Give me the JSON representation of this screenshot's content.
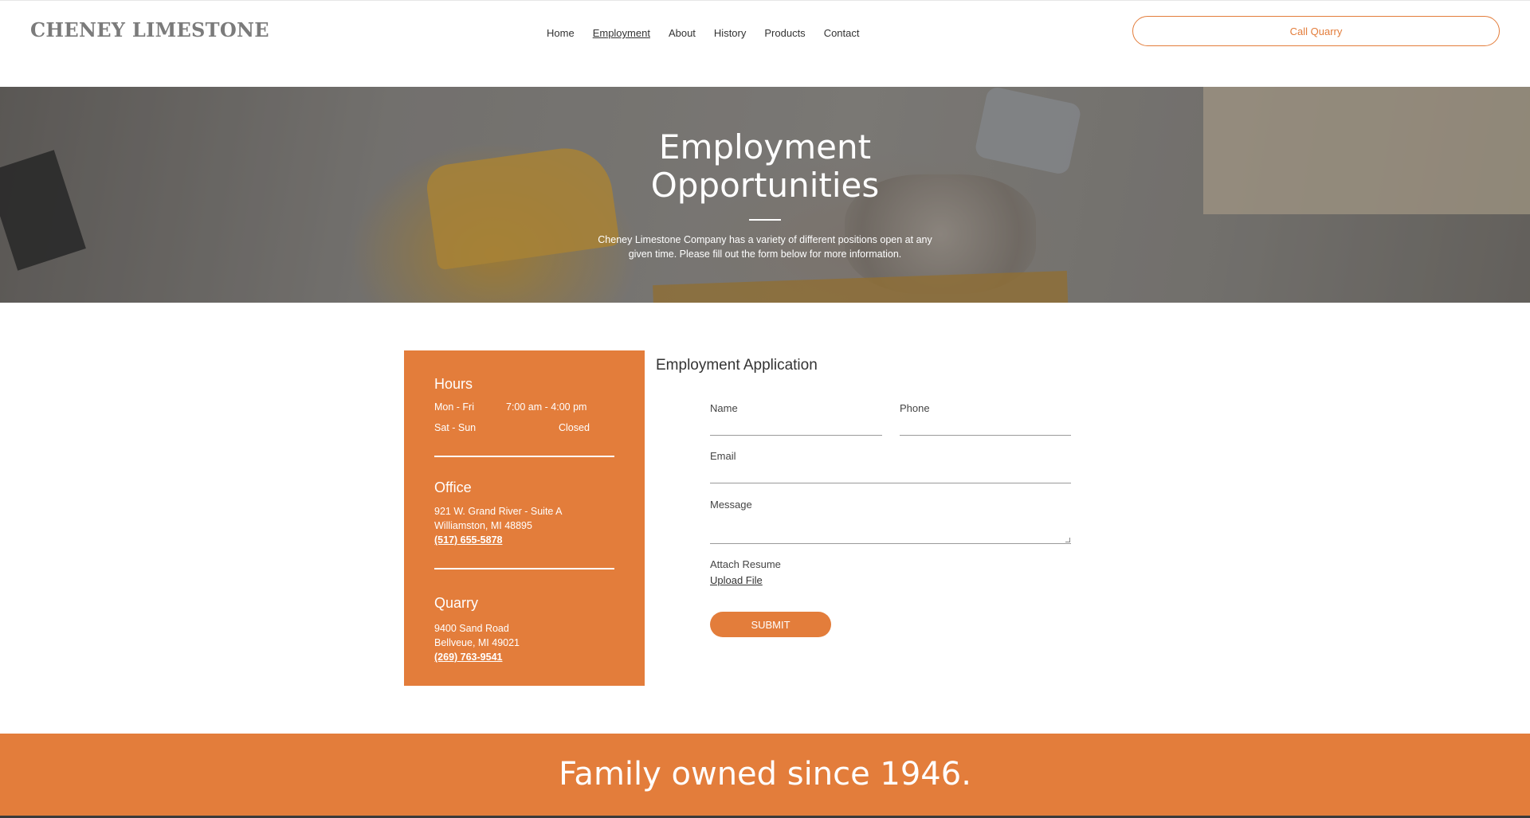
{
  "header": {
    "logo": "CHENEY LIMESTONE",
    "nav": [
      "Home",
      "Employment",
      "About",
      "History",
      "Products",
      "Contact"
    ],
    "active_nav": "Employment",
    "call_button": "Call Quarry"
  },
  "hero": {
    "title_line1": "Employment",
    "title_line2": "Opportunities",
    "subtitle": "Cheney Limestone Company has a variety of different positions open at any given time. Please fill out the form below for more information."
  },
  "card": {
    "hours_title": "Hours",
    "hours": [
      {
        "days": "Mon - Fri",
        "time": "7:00 am - 4:00 pm"
      },
      {
        "days": "Sat - Sun",
        "time": "Closed"
      }
    ],
    "office_title": "Office",
    "office_line1": "921 W. Grand River - Suite A",
    "office_line2": "Williamston, MI 48895",
    "office_phone": "(517) 655-5878",
    "quarry_title": "Quarry",
    "quarry_line1": "9400 Sand Road",
    "quarry_line2": "Bellveue, MI 49021",
    "quarry_phone": "(269) 763-9541"
  },
  "form": {
    "title": "Employment Application",
    "name_label": "Name",
    "phone_label": "Phone",
    "email_label": "Email",
    "message_label": "Message",
    "attach_label": "Attach Resume",
    "upload_label": "Upload File",
    "submit_label": "SUBMIT"
  },
  "footer": {
    "tagline": "Family owned since 1946."
  },
  "colors": {
    "accent": "#e37d3b",
    "text": "#333333"
  }
}
